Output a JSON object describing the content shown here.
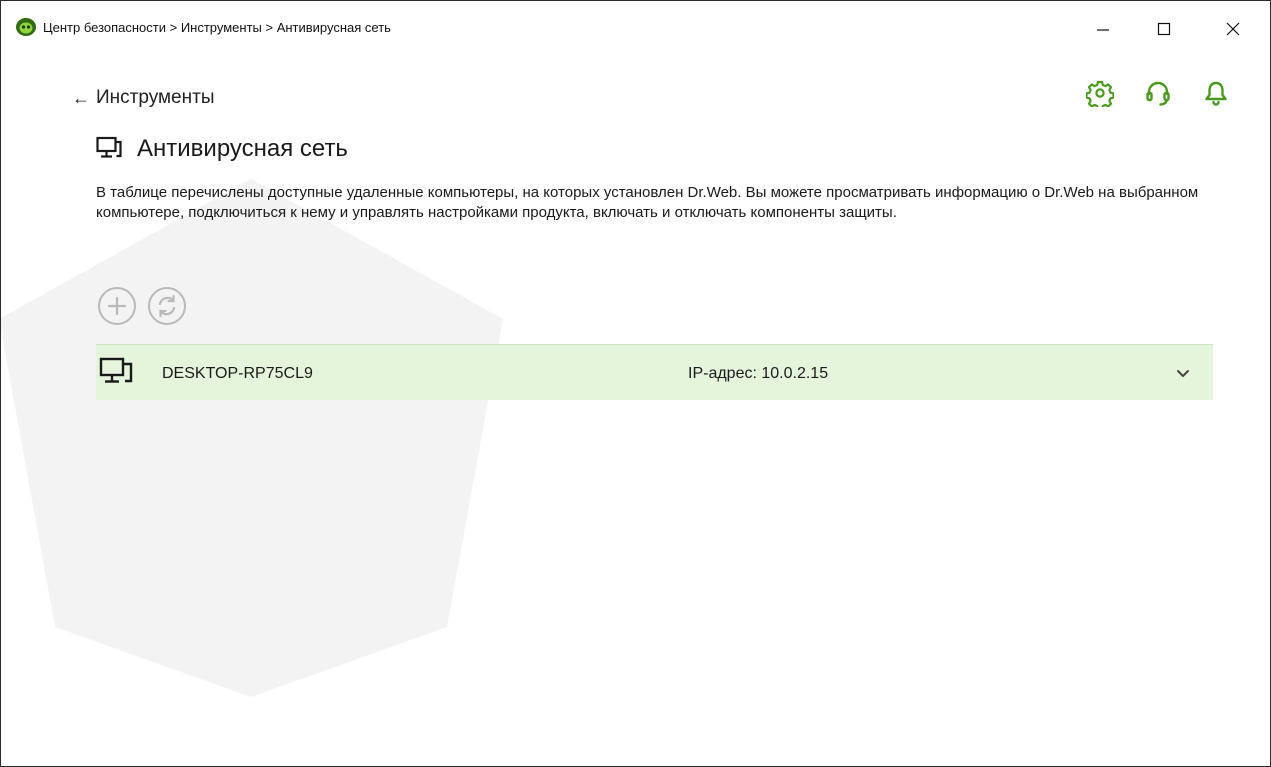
{
  "window": {
    "title": "Центр безопасности > Инструменты > Антивирусная сеть"
  },
  "nav": {
    "back_label": "Инструменты"
  },
  "header_icons": [
    "settings-icon",
    "support-icon",
    "bell-icon"
  ],
  "page": {
    "title": "Антивирусная сеть",
    "description": "В таблице перечислены доступные удаленные компьютеры, на которых установлен Dr.Web. Вы можете просматривать информацию о Dr.Web на выбранном компьютере, подключиться к нему и управлять настройками продукта, включать и отключать компоненты защиты."
  },
  "toolbar": {
    "buttons": [
      "add-icon",
      "refresh-icon"
    ]
  },
  "devices": [
    {
      "name": "DESKTOP-RP75CL9",
      "ip": "IP-адрес: 10.0.2.15"
    }
  ],
  "colors": {
    "accent": "#4a9a1e",
    "row_bg": "#e5f5dc",
    "disabled": "#b9b9b9"
  }
}
